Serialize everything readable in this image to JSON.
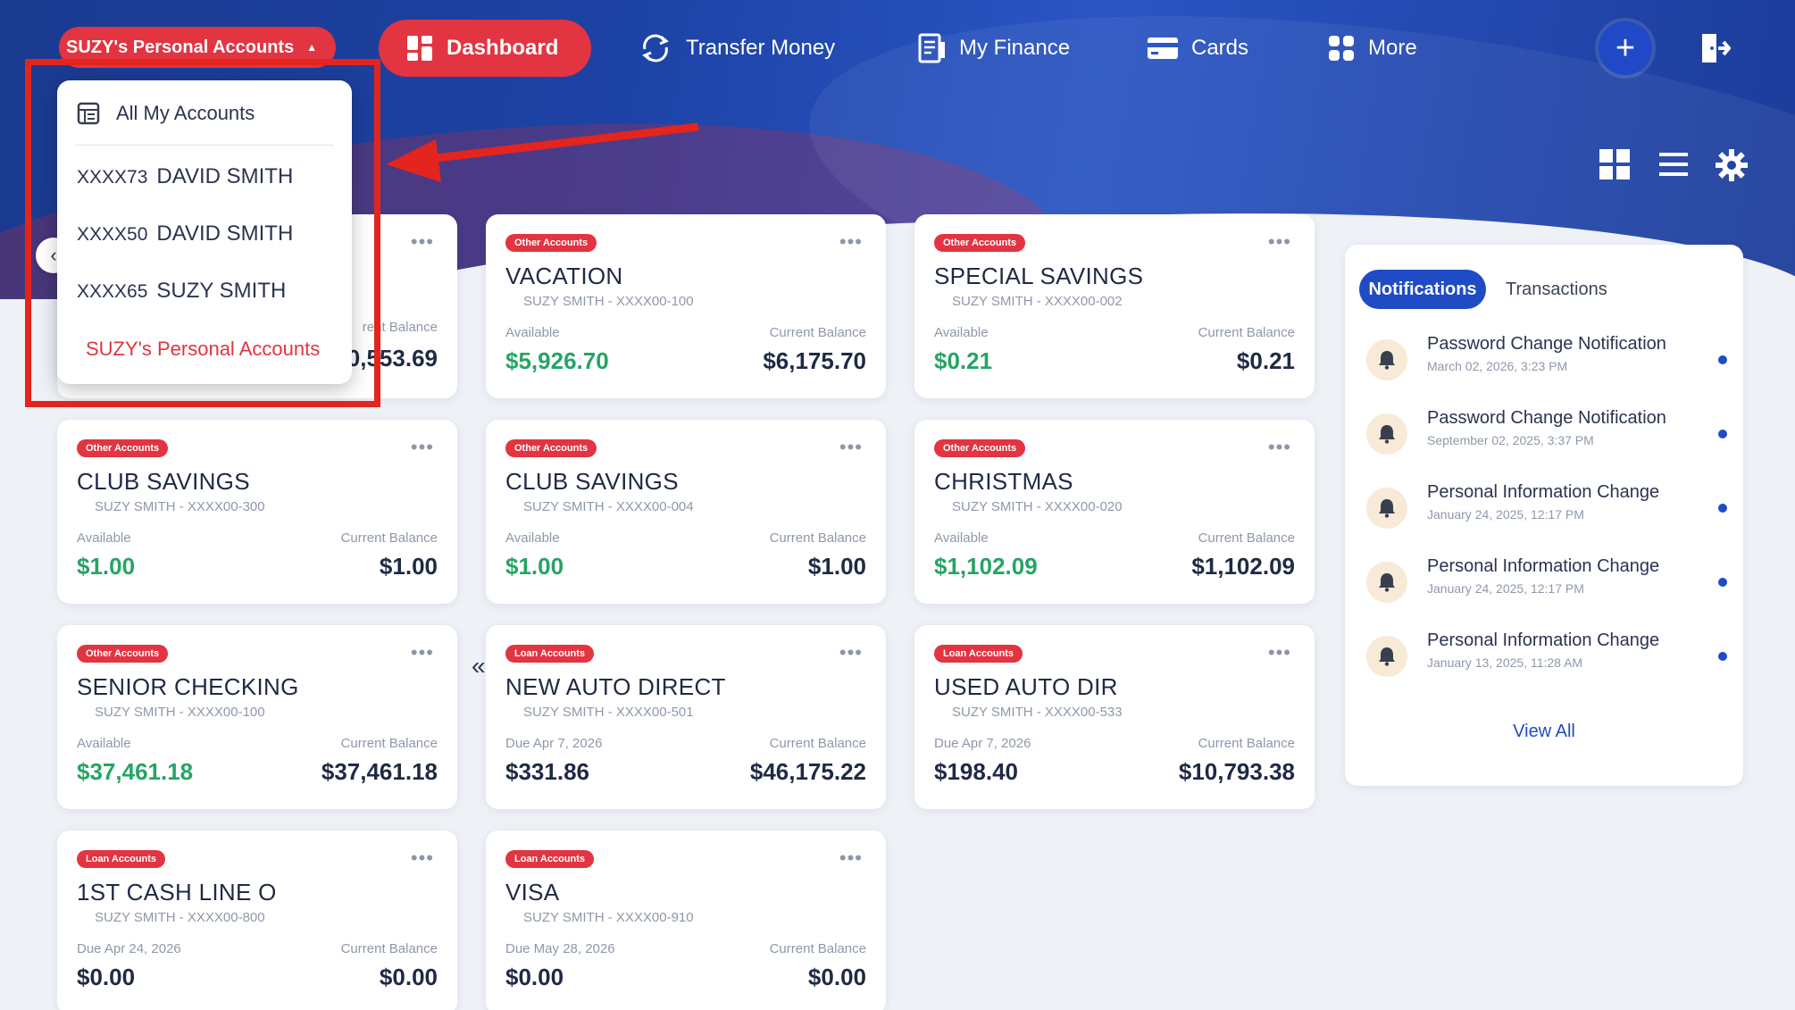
{
  "nav": {
    "account_selector": "SUZY's Personal Accounts",
    "dashboard": "Dashboard",
    "transfer": "Transfer Money",
    "finance": "My Finance",
    "cards": "Cards",
    "more": "More",
    "plus": "+"
  },
  "dropdown": {
    "all": "All My Accounts",
    "items": [
      {
        "mask": "XXXX73",
        "name": "DAVID SMITH"
      },
      {
        "mask": "XXXX50",
        "name": "DAVID SMITH"
      },
      {
        "mask": "XXXX65",
        "name": "SUZY SMITH"
      }
    ],
    "active": "SUZY's Personal Accounts"
  },
  "first_card": {
    "right_label_partial": "rent Balance",
    "right_value_partial": "0,553.69"
  },
  "cards": [
    {
      "tag": "Other Accounts",
      "name": "VACATION",
      "sub": "SUZY SMITH - XXXX00-100",
      "left_label": "Available",
      "left_value": "$5,926.70",
      "right_label": "Current Balance",
      "right_value": "$6,175.70",
      "left_green": true
    },
    {
      "tag": "Other Accounts",
      "name": "SPECIAL SAVINGS",
      "sub": "SUZY SMITH - XXXX00-002",
      "left_label": "Available",
      "left_value": "$0.21",
      "right_label": "Current Balance",
      "right_value": "$0.21",
      "left_green": true
    },
    {
      "tag": "Other Accounts",
      "name": "CLUB SAVINGS",
      "sub": "SUZY SMITH - XXXX00-300",
      "left_label": "Available",
      "left_value": "$1.00",
      "right_label": "Current Balance",
      "right_value": "$1.00",
      "left_green": true
    },
    {
      "tag": "Other Accounts",
      "name": "CLUB SAVINGS",
      "sub": "SUZY SMITH - XXXX00-004",
      "left_label": "Available",
      "left_value": "$1.00",
      "right_label": "Current Balance",
      "right_value": "$1.00",
      "left_green": true
    },
    {
      "tag": "Other Accounts",
      "name": "CHRISTMAS",
      "sub": "SUZY SMITH - XXXX00-020",
      "left_label": "Available",
      "left_value": "$1,102.09",
      "right_label": "Current Balance",
      "right_value": "$1,102.09",
      "left_green": true
    },
    {
      "tag": "Other Accounts",
      "name": "SENIOR CHECKING",
      "sub": "SUZY SMITH - XXXX00-100",
      "left_label": "Available",
      "left_value": "$37,461.18",
      "right_label": "Current Balance",
      "right_value": "$37,461.18",
      "left_green": true
    },
    {
      "tag": "Loan Accounts",
      "name": "NEW AUTO DIRECT",
      "sub": "SUZY SMITH - XXXX00-501",
      "left_label": "Due Apr 7, 2026",
      "left_value": "$331.86",
      "right_label": "Current Balance",
      "right_value": "$46,175.22",
      "left_green": false
    },
    {
      "tag": "Loan Accounts",
      "name": "USED AUTO DIR",
      "sub": "SUZY SMITH - XXXX00-533",
      "left_label": "Due Apr 7, 2026",
      "left_value": "$198.40",
      "right_label": "Current Balance",
      "right_value": "$10,793.38",
      "left_green": false
    },
    {
      "tag": "Loan Accounts",
      "name": "1ST CASH LINE O",
      "sub": "SUZY SMITH - XXXX00-800",
      "left_label": "Due Apr 24, 2026",
      "left_value": "$0.00",
      "right_label": "Current Balance",
      "right_value": "$0.00",
      "left_green": false
    },
    {
      "tag": "Loan Accounts",
      "name": "VISA",
      "sub": "SUZY SMITH - XXXX00-910",
      "left_label": "Due May 28, 2026",
      "left_value": "$0.00",
      "right_label": "Current Balance",
      "right_value": "$0.00",
      "left_green": false
    }
  ],
  "panel": {
    "tab_active": "Notifications",
    "tab_other": "Transactions",
    "notifications": [
      {
        "title": "Password Change Notification",
        "time": "March 02, 2026, 3:23 PM"
      },
      {
        "title": "Password Change Notification",
        "time": "September 02, 2025, 3:37 PM"
      },
      {
        "title": "Personal Information Change",
        "time": "January 24, 2025, 12:17 PM"
      },
      {
        "title": "Personal Information Change",
        "time": "January 24, 2025, 12:17 PM"
      },
      {
        "title": "Personal Information Change",
        "time": "January 13, 2025, 11:28 AM"
      }
    ],
    "view_all": "View All"
  },
  "colors": {
    "brand_red": "#e23441",
    "brand_blue": "#1f4bc4",
    "positive_green": "#26a465",
    "annotation_red": "#e3251e"
  }
}
